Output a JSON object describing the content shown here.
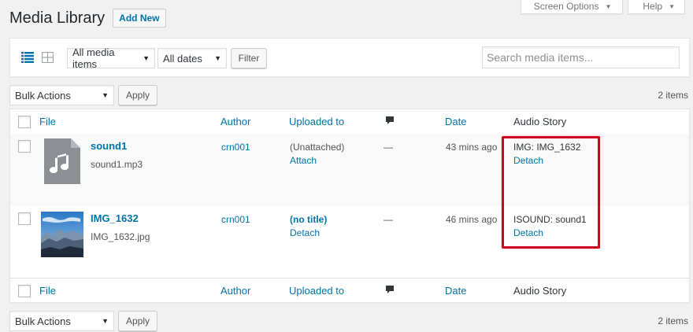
{
  "screen_options": {
    "label": "Screen Options",
    "help_label": "Help"
  },
  "header": {
    "title": "Media Library",
    "add_new": "Add New"
  },
  "filters": {
    "media_type": "All media items",
    "dates": "All dates",
    "filter_button": "Filter",
    "search_placeholder": "Search media items..."
  },
  "bulk_top": {
    "action": "Bulk Actions",
    "apply": "Apply",
    "count": "2 items"
  },
  "bulk_bottom": {
    "action": "Bulk Actions",
    "apply": "Apply",
    "count": "2 items"
  },
  "columns": {
    "file": "File",
    "author": "Author",
    "uploaded_to": "Uploaded to",
    "date": "Date",
    "audio_story": "Audio Story"
  },
  "rows": [
    {
      "title": "sound1",
      "filename": "sound1.mp3",
      "author": "crn001",
      "uploaded_to": "(Unattached)",
      "uploaded_action": "Attach",
      "comments": "—",
      "date": "43 mins ago",
      "audio_story": "IMG: IMG_1632",
      "audio_action": "Detach",
      "thumb_icon": "audio-file-icon"
    },
    {
      "title": "IMG_1632",
      "filename": "IMG_1632.jpg",
      "author": "crn001",
      "uploaded_to": "(no title)",
      "uploaded_action": "Detach",
      "comments": "—",
      "date": "46 mins ago",
      "audio_story": "ISOUND: sound1",
      "audio_action": "Detach",
      "thumb_icon": "mountain-photo-thumbnail"
    }
  ],
  "colors": {
    "accent": "#0073aa",
    "highlight": "#d0021b"
  }
}
